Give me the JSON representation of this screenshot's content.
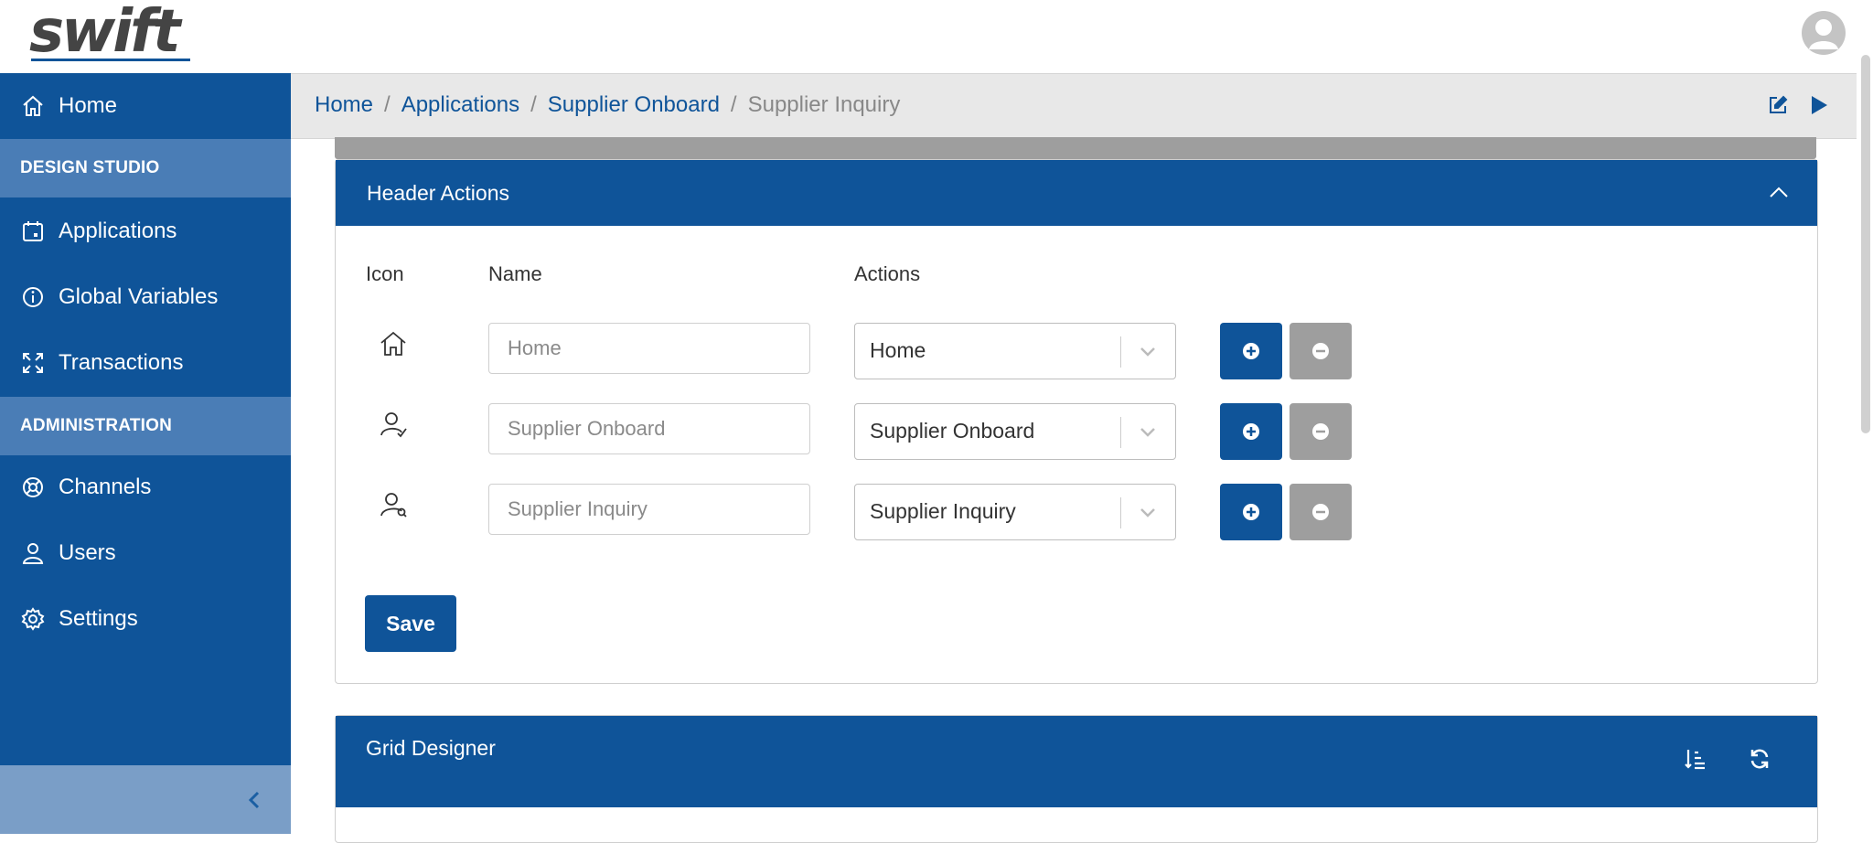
{
  "brand": {
    "logo_text": "swift",
    "accent": "#0f5499"
  },
  "sidebar": {
    "home": {
      "label": "Home",
      "icon": "home-icon"
    },
    "section_design": "DESIGN STUDIO",
    "applications": {
      "label": "Applications",
      "icon": "calendar-icon"
    },
    "global_variables": {
      "label": "Global Variables",
      "icon": "info-icon"
    },
    "transactions": {
      "label": "Transactions",
      "icon": "expand-icon"
    },
    "section_admin": "ADMINISTRATION",
    "channels": {
      "label": "Channels",
      "icon": "lifebuoy-icon"
    },
    "users": {
      "label": "Users",
      "icon": "user-icon"
    },
    "settings": {
      "label": "Settings",
      "icon": "gear-icon"
    }
  },
  "breadcrumb": {
    "items": [
      "Home",
      "Applications",
      "Supplier Onboard"
    ],
    "current": "Supplier Inquiry",
    "separator": "/"
  },
  "header_actions": {
    "title": "Header Actions",
    "columns": {
      "icon": "Icon",
      "name": "Name",
      "actions": "Actions"
    },
    "rows": [
      {
        "icon": "home-icon",
        "name_placeholder": "Home",
        "action": "Home"
      },
      {
        "icon": "user-check-icon",
        "name_placeholder": "Supplier Onboard",
        "action": "Supplier Onboard"
      },
      {
        "icon": "user-search-icon",
        "name_placeholder": "Supplier Inquiry",
        "action": "Supplier Inquiry"
      }
    ],
    "save_label": "Save"
  },
  "grid_designer": {
    "title": "Grid Designer"
  }
}
